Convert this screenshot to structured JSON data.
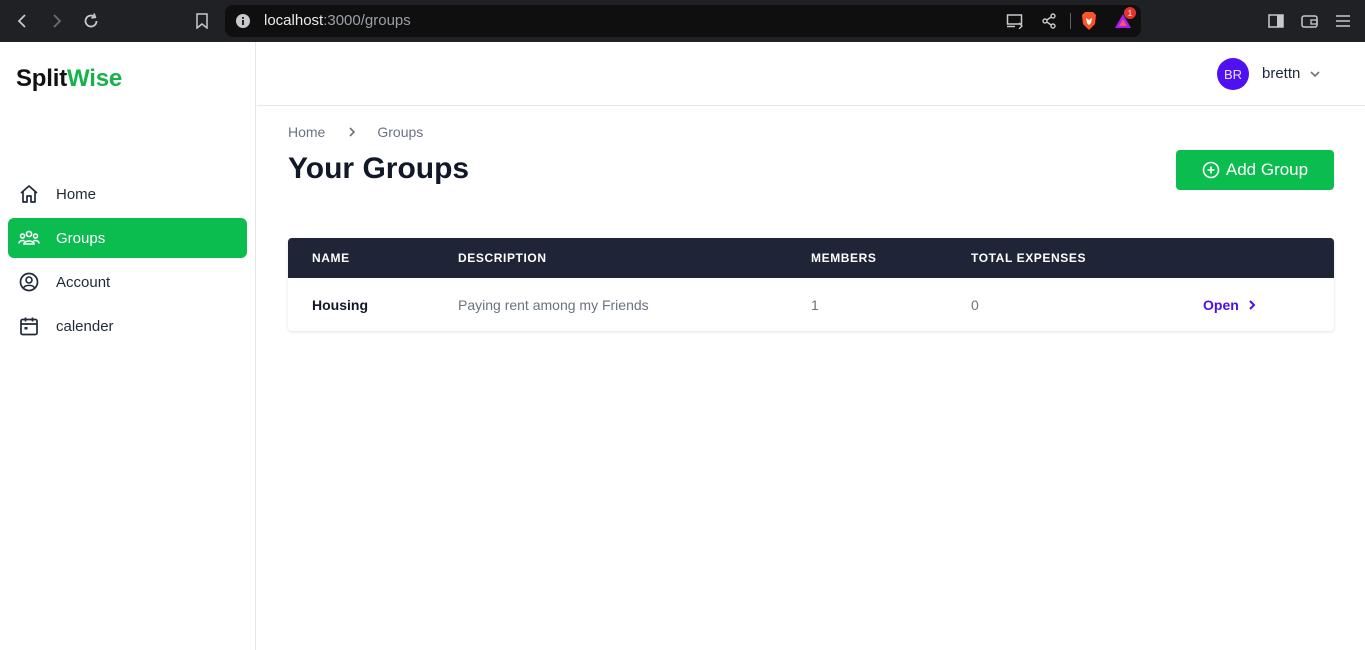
{
  "browser": {
    "url_host": "localhost",
    "url_path": ":3000/groups",
    "notification_count": "1"
  },
  "app": {
    "logo_part1": "Split",
    "logo_part2": "Wise",
    "accent_color": "#0bbd4e"
  },
  "sidebar": {
    "items": [
      {
        "label": "Home",
        "icon": "home-icon",
        "active": false
      },
      {
        "label": "Groups",
        "icon": "users-icon",
        "active": true
      },
      {
        "label": "Account",
        "icon": "user-circle-icon",
        "active": false
      },
      {
        "label": "calender",
        "icon": "calendar-icon",
        "active": false
      }
    ]
  },
  "user": {
    "initials": "BR",
    "name": "brettn"
  },
  "breadcrumb": {
    "home": "Home",
    "current": "Groups"
  },
  "page": {
    "title": "Your Groups",
    "add_button_label": "Add Group"
  },
  "table": {
    "headers": [
      "NAME",
      "DESCRIPTION",
      "MEMBERS",
      "TOTAL EXPENSES"
    ],
    "rows": [
      {
        "name": "Housing",
        "description": "Paying rent among my Friends",
        "members": "1",
        "total_expenses": "0",
        "action": "Open"
      }
    ]
  }
}
